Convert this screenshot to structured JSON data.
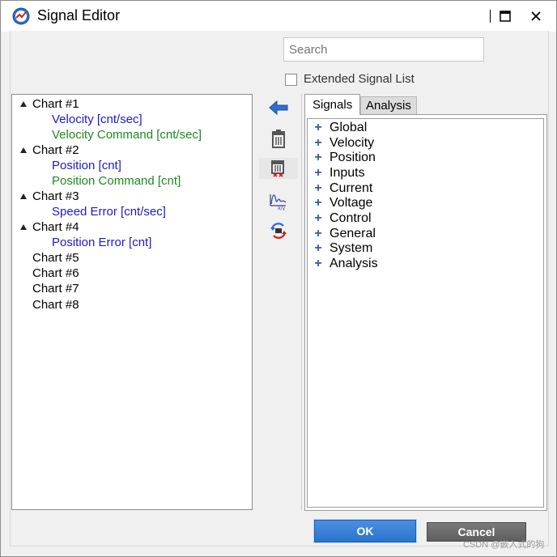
{
  "window": {
    "title": "Signal Editor"
  },
  "search": {
    "placeholder": "Search"
  },
  "extended_signal_list": {
    "label": "Extended Signal List",
    "checked": false
  },
  "chart_tree": [
    {
      "label": "Chart #1",
      "expanded": true,
      "children": [
        {
          "label": "Velocity [cnt/sec]",
          "color": "#1a1acc"
        },
        {
          "label": "Velocity Command [cnt/sec]",
          "color": "#1e8a1e"
        }
      ]
    },
    {
      "label": "Chart #2",
      "expanded": true,
      "children": [
        {
          "label": "Position [cnt]",
          "color": "#1a1acc"
        },
        {
          "label": "Position Command [cnt]",
          "color": "#1e8a1e"
        }
      ]
    },
    {
      "label": "Chart #3",
      "expanded": true,
      "children": [
        {
          "label": "Speed Error [cnt/sec]",
          "color": "#1a1acc"
        }
      ]
    },
    {
      "label": "Chart #4",
      "expanded": true,
      "children": [
        {
          "label": "Position Error [cnt]",
          "color": "#1a1acc"
        }
      ]
    },
    {
      "label": "Chart #5",
      "expanded": false,
      "children": []
    },
    {
      "label": "Chart #6",
      "expanded": false,
      "children": []
    },
    {
      "label": "Chart #7",
      "expanded": false,
      "children": []
    },
    {
      "label": "Chart #8",
      "expanded": false,
      "children": []
    }
  ],
  "toolbar_icons": [
    "add-signal-arrow-icon",
    "trash-icon",
    "delete-all-icon",
    "fft-icon",
    "swap-icon"
  ],
  "tabs": [
    {
      "label": "Signals",
      "active": true
    },
    {
      "label": "Analysis",
      "active": false
    }
  ],
  "signal_groups": [
    "Global",
    "Velocity",
    "Position",
    "Inputs",
    "Current",
    "Voltage",
    "Control",
    "General",
    "System",
    "Analysis"
  ],
  "buttons": {
    "ok": "OK",
    "cancel": "Cancel"
  },
  "watermark": "CSDN @嵌入式的狗",
  "colors": {
    "child_blue": "#1a1acc",
    "child_green": "#1e8a1e",
    "ok_button": "#2a73cc",
    "plus_icon": "#2e5f9c"
  }
}
